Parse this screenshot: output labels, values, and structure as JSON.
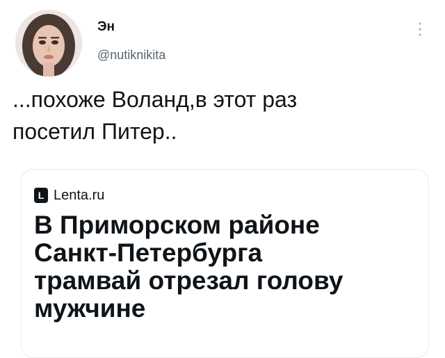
{
  "tweet": {
    "author": {
      "display_name": "Эн",
      "handle": "@nutiknikita",
      "avatar_icon": "profile-photo"
    },
    "more_icon": "more-options-icon",
    "text_lines": [
      "...похоже Воланд,в этот раз",
      "посетил Питер.."
    ],
    "card": {
      "source_logo_letter": "L",
      "source_name": "Lenta.ru",
      "headline_lines": [
        "В Приморском районе",
        "Санкт-Петербурга",
        "трамвай отрезал голову",
        "мужчине"
      ]
    }
  },
  "colors": {
    "text_primary": "#0f1419",
    "text_secondary": "#536471",
    "card_border": "#e6ecf0",
    "background": "#ffffff"
  }
}
